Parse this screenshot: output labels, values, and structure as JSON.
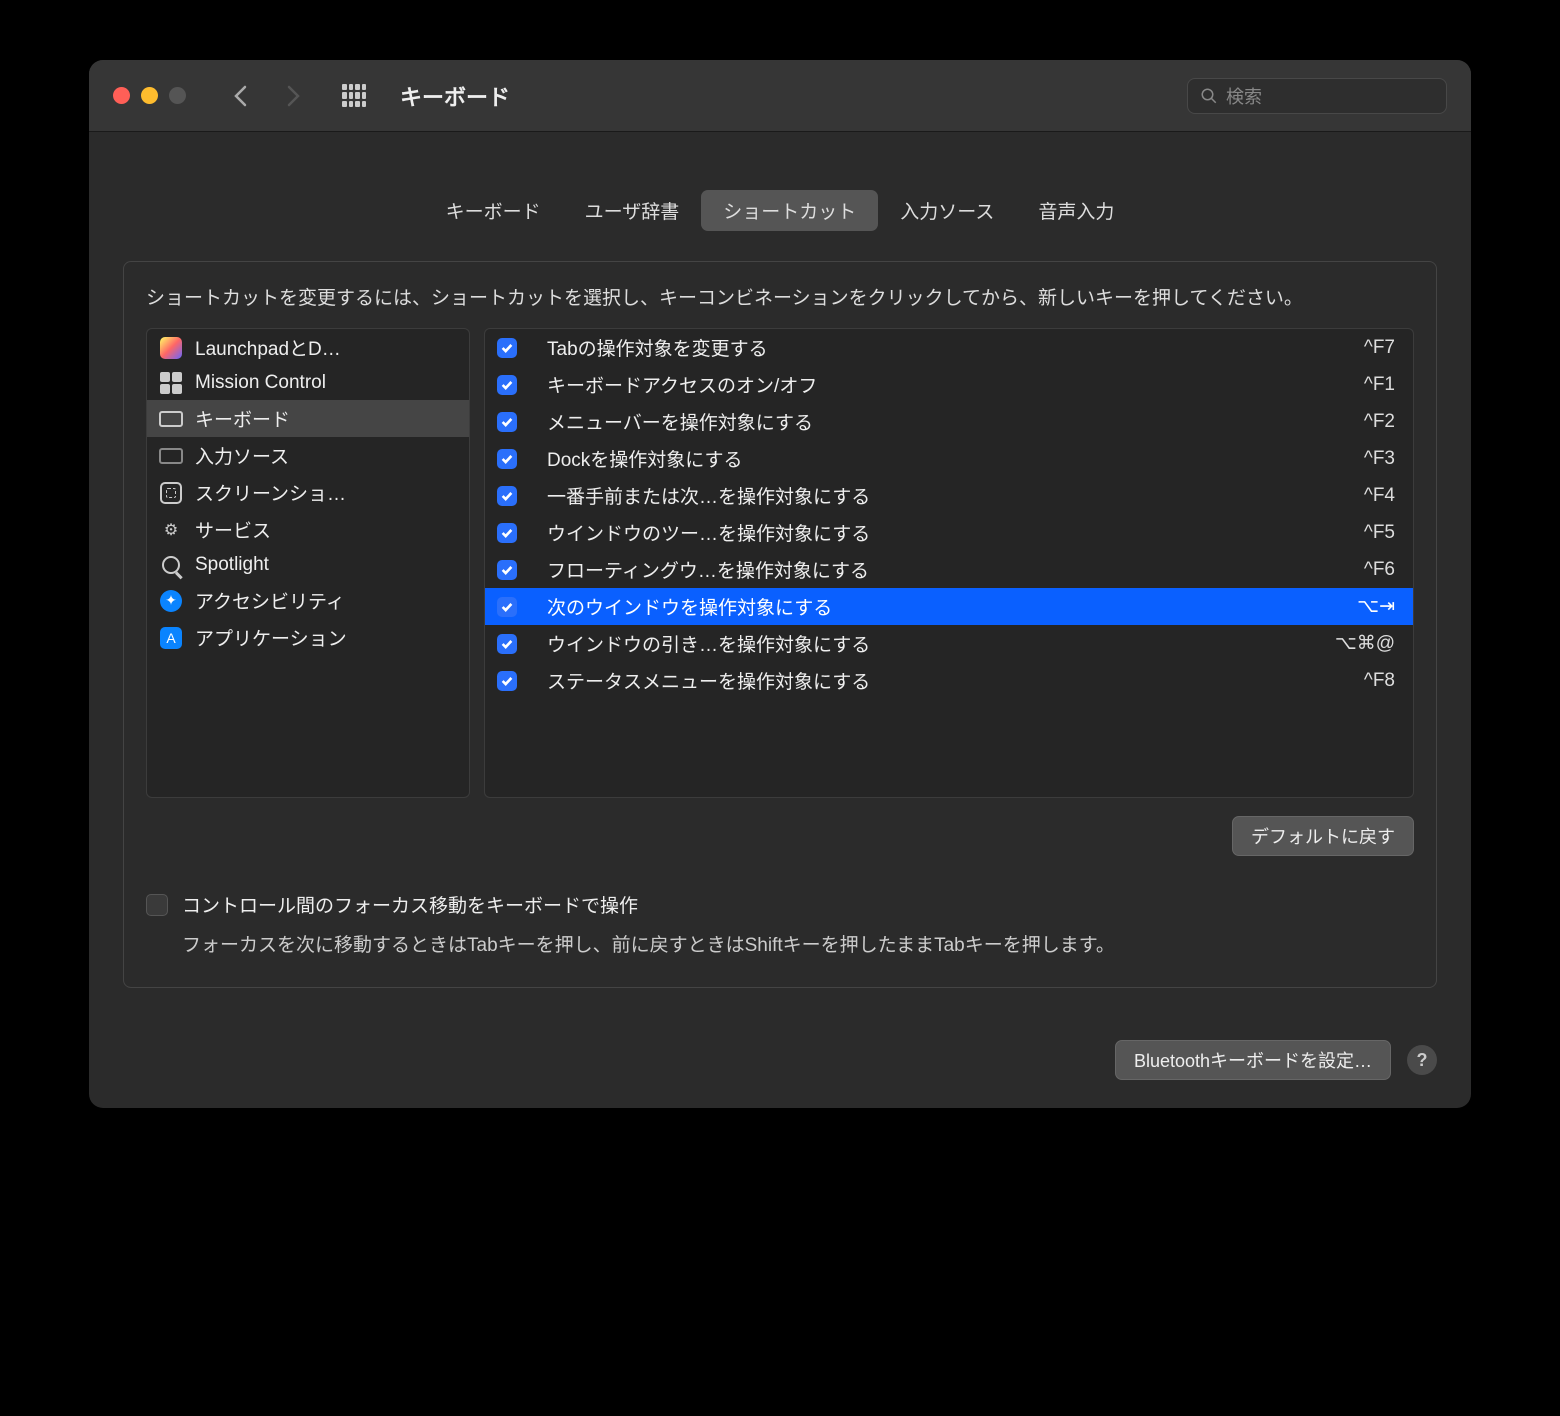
{
  "title": "キーボード",
  "search_placeholder": "検索",
  "tabs": [
    {
      "label": "キーボード"
    },
    {
      "label": "ユーザ辞書"
    },
    {
      "label": "ショートカット",
      "active": true
    },
    {
      "label": "入力ソース"
    },
    {
      "label": "音声入力"
    }
  ],
  "instruction": "ショートカットを変更するには、ショートカットを選択し、キーコンビネーションをクリックしてから、新しいキーを押してください。",
  "sidebar": {
    "items": [
      {
        "label": "LaunchpadとD…",
        "icon": "launchpad"
      },
      {
        "label": "Mission Control",
        "icon": "mission"
      },
      {
        "label": "キーボード",
        "icon": "keyboard",
        "selected": true
      },
      {
        "label": "入力ソース",
        "icon": "input"
      },
      {
        "label": "スクリーンショ…",
        "icon": "screenshot"
      },
      {
        "label": "サービス",
        "icon": "gear"
      },
      {
        "label": "Spotlight",
        "icon": "spotlight"
      },
      {
        "label": "アクセシビリティ",
        "icon": "accessibility"
      },
      {
        "label": "アプリケーション",
        "icon": "app"
      }
    ]
  },
  "shortcuts": [
    {
      "checked": true,
      "label": "Tabの操作対象を変更する",
      "key": "^F7"
    },
    {
      "checked": true,
      "label": "キーボードアクセスのオン/オフ",
      "key": "^F1"
    },
    {
      "checked": true,
      "label": "メニューバーを操作対象にする",
      "key": "^F2"
    },
    {
      "checked": true,
      "label": "Dockを操作対象にする",
      "key": "^F3"
    },
    {
      "checked": true,
      "label": "一番手前または次…を操作対象にする",
      "key": "^F4"
    },
    {
      "checked": true,
      "label": "ウインドウのツー…を操作対象にする",
      "key": "^F5"
    },
    {
      "checked": true,
      "label": "フローティングウ…を操作対象にする",
      "key": "^F6"
    },
    {
      "checked": true,
      "label": "次のウインドウを操作対象にする",
      "key": "⌥⇥",
      "selected": true
    },
    {
      "checked": true,
      "label": "ウインドウの引き…を操作対象にする",
      "key": "⌥⌘@"
    },
    {
      "checked": true,
      "label": "ステータスメニューを操作対象にする",
      "key": "^F8"
    }
  ],
  "restore_button": "デフォルトに戻す",
  "focus_checkbox_label": "コントロール間のフォーカス移動をキーボードで操作",
  "focus_description": "フォーカスを次に移動するときはTabキーを押し、前に戻すときはShiftキーを押したままTabキーを押します。",
  "bluetooth_button": "Bluetoothキーボードを設定…"
}
